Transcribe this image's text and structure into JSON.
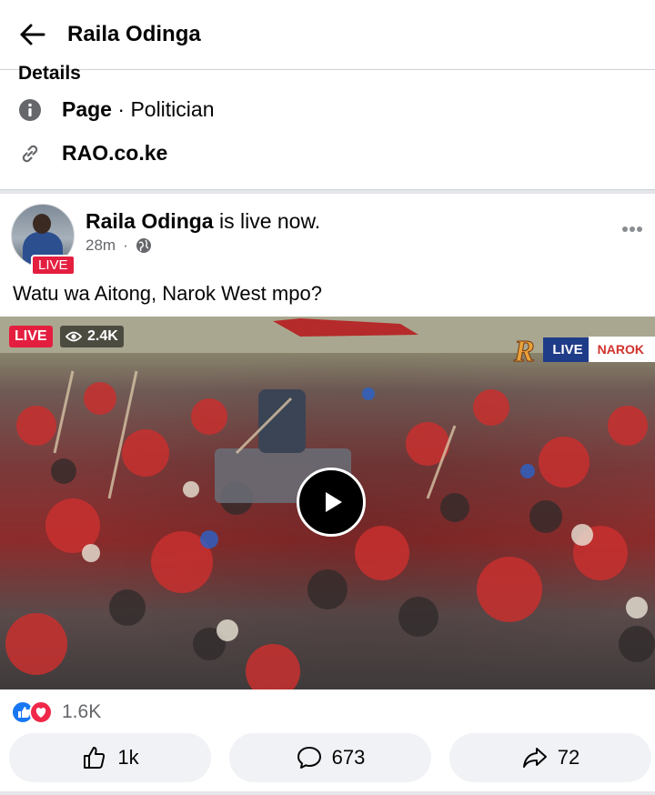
{
  "header": {
    "title": "Raila Odinga"
  },
  "details": {
    "heading": "Details",
    "page_type_label": "Page",
    "page_category": "Politician",
    "website": "RAO.co.ke"
  },
  "post": {
    "author": "Raila Odinga",
    "status": "is live now.",
    "time": "28m",
    "avatar_badge": "LIVE",
    "text": "Watu wa Aitong, Narok West mpo?",
    "video": {
      "live_label": "LIVE",
      "viewers": "2.4K",
      "channel_live": "LIVE",
      "channel_location": "NAROK"
    },
    "reactions_count": "1.6K",
    "actions": {
      "like_count": "1k",
      "comment_count": "673",
      "share_count": "72"
    }
  },
  "colors": {
    "live_red": "#e41e3f",
    "fb_blue": "#1877f2",
    "muted": "#65676b",
    "button_bg": "#f0f2f5"
  }
}
